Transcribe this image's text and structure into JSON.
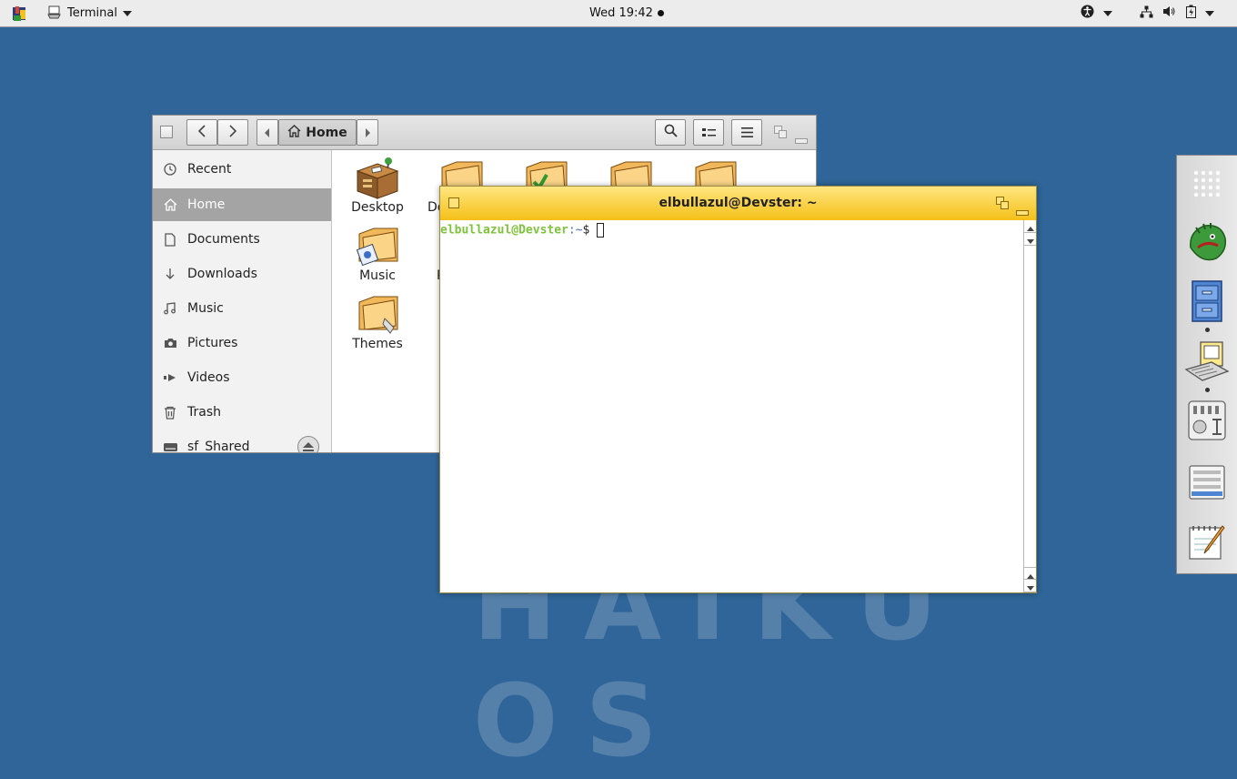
{
  "topbar": {
    "app_name": "Terminal",
    "clock": "Wed 19:42"
  },
  "desktop": {
    "watermark": "HAIKU OS"
  },
  "file_manager": {
    "location": "Home",
    "sidebar": [
      {
        "label": "Recent",
        "icon": "clock-icon",
        "selected": false
      },
      {
        "label": "Home",
        "icon": "home-icon",
        "selected": true
      },
      {
        "label": "Documents",
        "icon": "document-icon",
        "selected": false
      },
      {
        "label": "Downloads",
        "icon": "download-icon",
        "selected": false
      },
      {
        "label": "Music",
        "icon": "music-icon",
        "selected": false
      },
      {
        "label": "Pictures",
        "icon": "camera-icon",
        "selected": false
      },
      {
        "label": "Videos",
        "icon": "video-icon",
        "selected": false
      },
      {
        "label": "Trash",
        "icon": "trash-icon",
        "selected": false
      },
      {
        "label": "sf_Shared",
        "icon": "drive-icon",
        "selected": false
      }
    ],
    "files": [
      {
        "label": "Desktop"
      },
      {
        "label": "Do"
      },
      {
        "label": "Music"
      },
      {
        "label": "P"
      },
      {
        "label": "Themes"
      }
    ]
  },
  "terminal": {
    "title": "elbullazul@Devster: ~",
    "prompt_user": "elbullazul@Devster",
    "prompt_path": ":~",
    "prompt_symbol": "$",
    "colors": {
      "prompt_user": "#7ec43a",
      "titlebar": "#f8cc2e"
    }
  },
  "dock": {
    "items": [
      "app-grid-icon",
      "haiku-depot-icon",
      "file-cabinet-icon",
      "computer-icon",
      "preferences-icon",
      "panel-settings-icon",
      "text-editor-icon"
    ]
  },
  "colors": {
    "desktop": "#2f6598",
    "sidebar_selected": "#a4a4a4"
  }
}
